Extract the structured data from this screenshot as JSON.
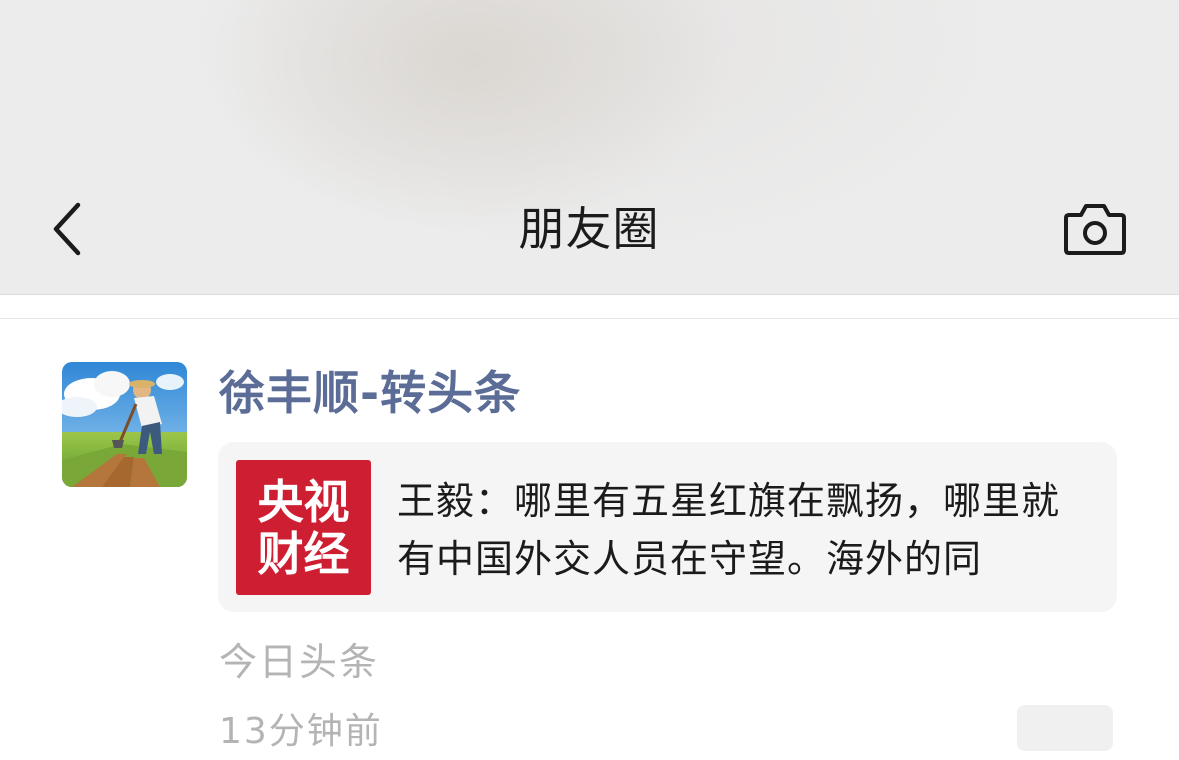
{
  "header": {
    "title": "朋友圈",
    "back_icon": "chevron-left-icon",
    "camera_icon": "camera-icon"
  },
  "post": {
    "username": "徐丰顺-转头条",
    "share": {
      "thumb_line1": "央视",
      "thumb_line2": "财经",
      "thumb_color": "#ce1e32",
      "text": "王毅：哪里有五星红旗在飘扬，哪里就有中国外交人员在守望。海外的同"
    },
    "source": "今日头条",
    "time": "13分钟前"
  },
  "colors": {
    "username": "#5b6d96",
    "muted": "#b4b4b4",
    "header_bg": "#ececec"
  }
}
